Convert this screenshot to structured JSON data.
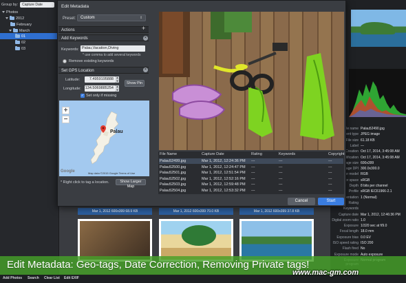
{
  "sidebar": {
    "group_by_label": "Group by:",
    "group_by_value": "Capture Date",
    "tree": [
      {
        "label": "Photos"
      },
      {
        "label": "2012"
      },
      {
        "label": "February"
      },
      {
        "label": "March"
      },
      {
        "label": "01"
      },
      {
        "label": "02"
      },
      {
        "label": "03"
      }
    ]
  },
  "modal": {
    "title": "Edit Metadata",
    "preset_label": "Preset:",
    "preset_value": "Custom",
    "actions_header": "Actions",
    "add_keywords": {
      "header": "Add Keywords",
      "keywords_label": "Keywords:",
      "keywords_value": "Palau,Vacation,Diving",
      "hint": "* use comma to add several keywords",
      "remove_existing": "Remove existing keywords"
    },
    "gps": {
      "header": "Set GPS Location",
      "latitude_label": "Latitude:",
      "latitude_value": "7.4959195888",
      "longitude_label": "Longitude:",
      "longitude_value": "134.5069885254",
      "show_pin": "Show Pin",
      "set_only_if_missing": "Set only if missing",
      "map_label": "Palau",
      "map_credit": "Map data ©2015 Google   Terms of Use",
      "map_brand": "Google",
      "right_click_hint": "* Right click to tag a location.",
      "show_larger_map": "Show Larger Map"
    },
    "table": {
      "columns": [
        "File Name",
        "Capture Date",
        "Rating",
        "Keywords",
        "Copyright"
      ],
      "rows": [
        {
          "file": "Palau52499.jpg",
          "date": "Mar 1, 2012, 12:24:36 PM",
          "rating": "---",
          "keywords": "---",
          "copyright": "---"
        },
        {
          "file": "Palau52500.jpg",
          "date": "Mar 1, 2012, 12:24:47 PM",
          "rating": "---",
          "keywords": "---",
          "copyright": "---"
        },
        {
          "file": "Palau52501.jpg",
          "date": "Mar 1, 2012, 12:51:54 PM",
          "rating": "---",
          "keywords": "---",
          "copyright": "---"
        },
        {
          "file": "Palau52502.jpg",
          "date": "Mar 1, 2012, 12:52:16 PM",
          "rating": "---",
          "keywords": "---",
          "copyright": "---"
        },
        {
          "file": "Palau52503.jpg",
          "date": "Mar 1, 2012, 12:59:48 PM",
          "rating": "---",
          "keywords": "---",
          "copyright": "---"
        },
        {
          "file": "Palau52504.jpg",
          "date": "Mar 1, 2012, 12:53:32 PM",
          "rating": "---",
          "keywords": "---",
          "copyright": "---"
        }
      ]
    },
    "cancel": "Cancel",
    "start": "Start"
  },
  "thumbnails": [
    {
      "caption": "Mar 1, 2012   600x399   68.9 KB"
    },
    {
      "caption": "Mar 1, 2012   600x399   70.0 KB"
    },
    {
      "caption": "Mar 1, 2012   600x399   37.8 KB"
    }
  ],
  "inspector": {
    "rows": [
      {
        "k": "File name",
        "v": "Palau52490.jpg"
      },
      {
        "k": "ment type",
        "v": "JPEG image"
      },
      {
        "k": "File size",
        "v": "61.18 KB"
      },
      {
        "k": "Label",
        "v": "—"
      },
      {
        "k": "Creation",
        "v": "Oct 17, 2014, 3:45:08 AM"
      },
      {
        "k": "dification",
        "v": "Oct 17, 2014, 3:45:08 AM"
      },
      {
        "k": "age size",
        "v": "600x399"
      },
      {
        "k": "age DPI",
        "v": "300.0x300.0"
      },
      {
        "k": "lor model",
        "v": "RGB"
      },
      {
        "k": "or space",
        "v": "sRGB"
      },
      {
        "k": "Depth",
        "v": "8 bits per channel"
      },
      {
        "k": "Profile",
        "v": "sRGB IEC61966-2.1"
      },
      {
        "k": "entation",
        "v": "1 (Normal)"
      },
      {
        "k": "Rating",
        "v": ""
      },
      {
        "k": "Keywords",
        "v": ""
      },
      {
        "k": "Capture date",
        "v": "Mar 1, 2012, 12:46:36 PM"
      },
      {
        "k": "Digital zoom ratio",
        "v": "1.0"
      },
      {
        "k": "Exposure",
        "v": "1/320 sec at f/9.0"
      },
      {
        "k": "Focal length",
        "v": "18.0 mm"
      },
      {
        "k": "Exposure bias",
        "v": "0.0 EV"
      },
      {
        "k": "ISO speed rating",
        "v": "ISO 200"
      },
      {
        "k": "Flash fired",
        "v": "No"
      },
      {
        "k": "Exposure mode",
        "v": "Auto exposure"
      },
      {
        "k": "Exposure program",
        "v": "Normal program"
      }
    ]
  },
  "toolbar": {
    "add_photos": "Add Photos",
    "search": "Search",
    "clear_list": "Clear List",
    "edit_exif": "Edit EXIF"
  },
  "caption": "Edit Metadata: Geo-tags, Date Correction, Removing Private tags!",
  "watermark": "www.mac-gm.com"
}
